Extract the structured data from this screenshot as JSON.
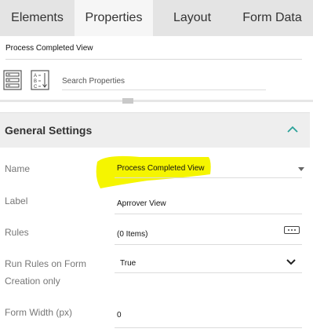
{
  "tabs": [
    "Elements",
    "Properties",
    "Layout",
    "Form Data"
  ],
  "active_tab": "Properties",
  "view_name": "Process Completed View",
  "toolbar": {
    "search_placeholder": "Search Properties",
    "icons": [
      "categorized-list-icon",
      "alphabetical-sort-icon"
    ]
  },
  "section": {
    "title": "General Settings",
    "expanded": true
  },
  "properties": {
    "name": {
      "label": "Name",
      "value": "Process Completed View"
    },
    "label": {
      "label": "Label",
      "value": "Aprrover View"
    },
    "rules": {
      "label": "Rules",
      "value": "(0 Items)"
    },
    "run_rules": {
      "label_line1": "Run Rules on Form",
      "label_line2": "Creation only",
      "value": "True"
    },
    "form_width": {
      "label": "Form Width (px)",
      "value": "0"
    }
  },
  "colors": {
    "highlight": "#f5f500",
    "accent": "#2aa198",
    "tab_bar": "#e4e4e4",
    "active_tab": "#f6f6f6",
    "section_bg": "#eeeeee"
  }
}
